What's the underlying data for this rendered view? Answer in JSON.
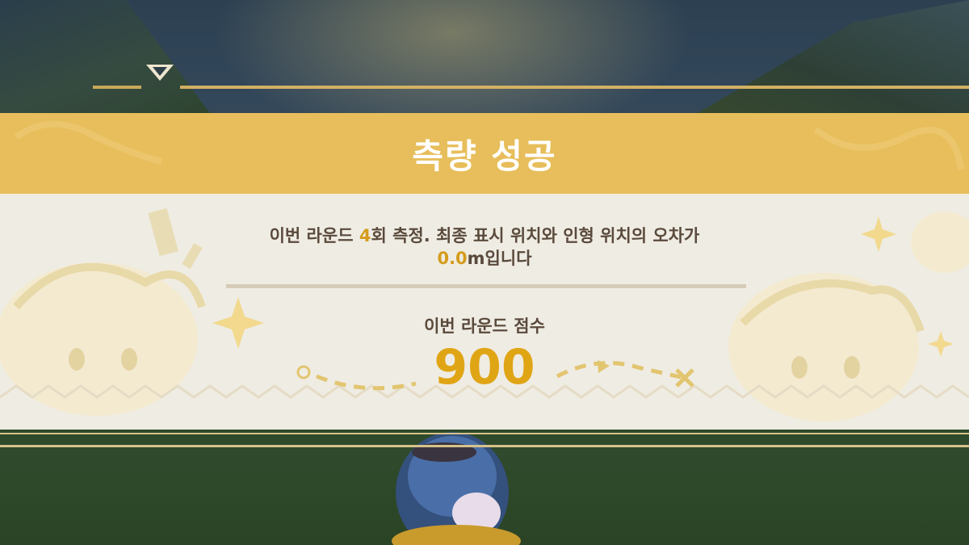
{
  "result": {
    "title": "측량 성공",
    "message_part1": "이번 라운드 ",
    "message_count": "4",
    "message_part2": "회 측정. 최종 표시 위치와 인형 위치의 오차가",
    "message_error": "0.0",
    "message_part3": "m입니다",
    "score_label": "이번 라운드 점수",
    "score_value": "900"
  },
  "colors": {
    "banner": "#e7be5b",
    "panel": "#efece3",
    "accent": "#e0a515",
    "text": "#5a4a3c"
  }
}
